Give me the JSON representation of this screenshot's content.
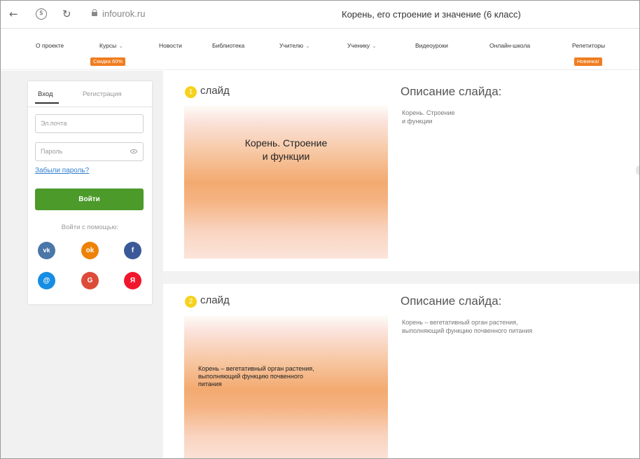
{
  "browser": {
    "url": "infourok.ru",
    "title": "Корень, его строение и значение (6 класс)"
  },
  "nav": {
    "items": [
      {
        "label": "О проекте"
      },
      {
        "label": "Курсы"
      },
      {
        "label": "Новости"
      },
      {
        "label": "Библиотека"
      },
      {
        "label": "Учителю"
      },
      {
        "label": "Ученику"
      },
      {
        "label": "Видеоуроки"
      },
      {
        "label": "Онлайн-школа"
      },
      {
        "label": "Репетиторы"
      }
    ],
    "badges": {
      "courses": "Скидка 60%",
      "tutors": "Новинка!"
    }
  },
  "login": {
    "tab_login": "Вход",
    "tab_register": "Регистрация",
    "email_placeholder": "Эл.почта",
    "password_placeholder": "Пароль",
    "forgot": "Забыли пароль?",
    "submit": "Войти",
    "social_label": "Войти с помощью:",
    "socials": [
      {
        "name": "vk",
        "glyph": "vk",
        "color": "#4a76a8"
      },
      {
        "name": "odnoklassniki",
        "glyph": "ok",
        "color": "#ee8208"
      },
      {
        "name": "facebook",
        "glyph": "f",
        "color": "#3b5998"
      },
      {
        "name": "mailru",
        "glyph": "@",
        "color": "#168de2"
      },
      {
        "name": "google",
        "glyph": "G",
        "color": "#dd4b39"
      },
      {
        "name": "yandex",
        "glyph": "Я",
        "color": "#f0172d"
      }
    ]
  },
  "slides": [
    {
      "number": "1",
      "word": "слайд",
      "thumb_text": "Корень. Строение\nи функции",
      "desc_head": "Описание слайда:",
      "desc_text": "Корень. Строение\nи функции"
    },
    {
      "number": "2",
      "word": "слайд",
      "thumb_text": "Корень – вегетативный орган растения,\nвыполняющий функцию почвенного\nпитания",
      "desc_head": "Описание слайда:",
      "desc_text": "Корень – вегетативный орган растения,\nвыполняющий функцию почвенного питания"
    }
  ],
  "colors": {
    "accent_green": "#4c9a2a",
    "badge_orange": "#f07d1f",
    "link_blue": "#2f7fd3",
    "slide_number": "#f6d21d"
  }
}
